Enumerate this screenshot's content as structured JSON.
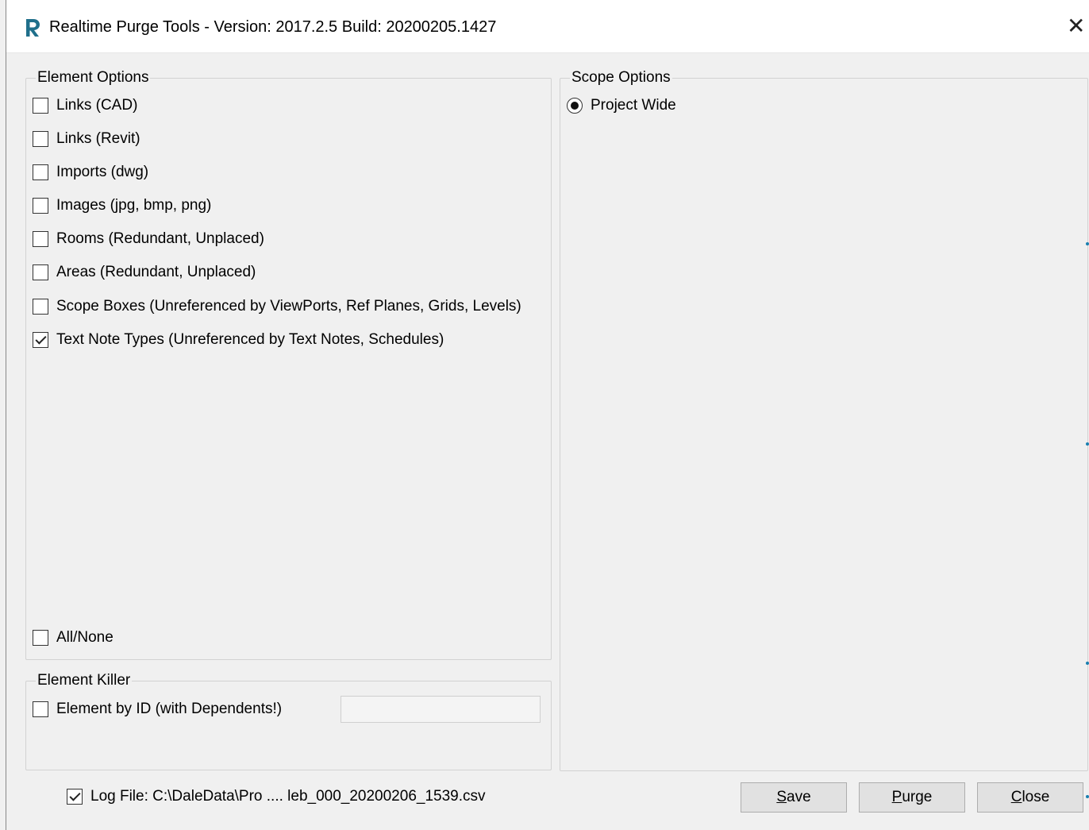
{
  "window": {
    "title": "Realtime Purge Tools - Version: 2017.2.5 Build: 20200205.1427",
    "close_glyph": "✕",
    "icon": "realtime-r-logo-icon",
    "accent_color": "#1f6f8b"
  },
  "element_options": {
    "legend": "Element Options",
    "items": [
      {
        "label": "Links (CAD)",
        "checked": false
      },
      {
        "label": "Links (Revit)",
        "checked": false
      },
      {
        "label": "Imports (dwg)",
        "checked": false
      },
      {
        "label": "Images (jpg, bmp, png)",
        "checked": false
      },
      {
        "label": "Rooms (Redundant, Unplaced)",
        "checked": false
      },
      {
        "label": "Areas (Redundant, Unplaced)",
        "checked": false
      },
      {
        "label": "Scope Boxes (Unreferenced by ViewPorts, Ref Planes, Grids, Levels)",
        "checked": false
      },
      {
        "label": "Text Note Types (Unreferenced by Text Notes, Schedules)",
        "checked": true
      }
    ],
    "all_none": {
      "label": "All/None",
      "checked": false
    }
  },
  "element_killer": {
    "legend": "Element Killer",
    "by_id": {
      "label": "Element by ID (with Dependents!)",
      "checked": false
    },
    "id_value": ""
  },
  "scope_options": {
    "legend": "Scope Options",
    "radio": {
      "label": "Project Wide",
      "selected": true
    }
  },
  "log_file": {
    "label": "Log File:  C:\\DaleData\\Pro .... leb_000_20200206_1539.csv",
    "checked": true
  },
  "buttons": {
    "save": {
      "underline": "S",
      "rest": "ave"
    },
    "purge": {
      "underline": "P",
      "rest": "urge"
    },
    "close": {
      "underline": "C",
      "rest": "lose"
    }
  }
}
